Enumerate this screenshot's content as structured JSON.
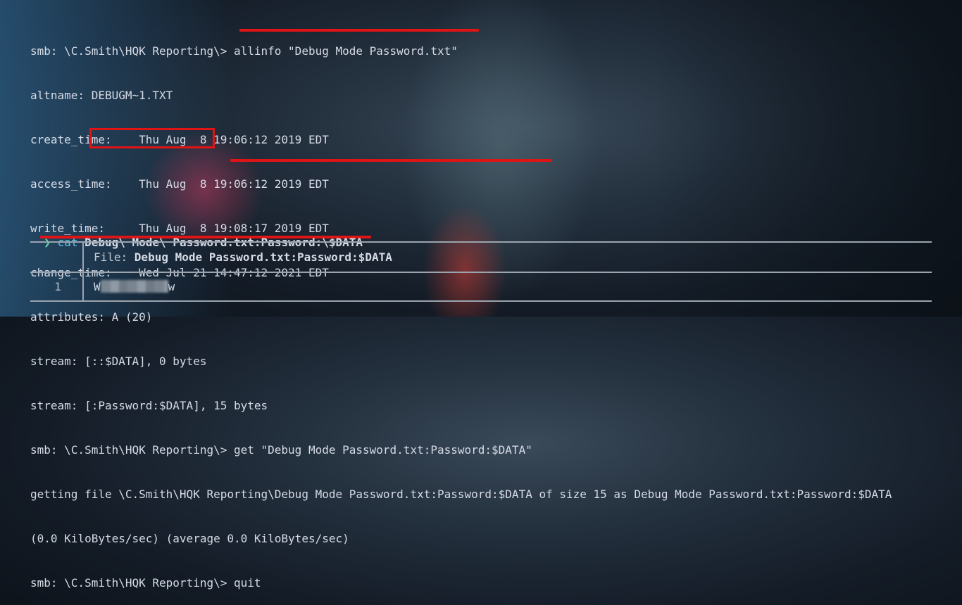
{
  "terminal": {
    "lines": [
      "smb: \\C.Smith\\HQK Reporting\\> allinfo \"Debug Mode Password.txt\"",
      "altname: DEBUGM~1.TXT",
      "create_time:    Thu Aug  8 19:06:12 2019 EDT",
      "access_time:    Thu Aug  8 19:06:12 2019 EDT",
      "write_time:     Thu Aug  8 19:08:17 2019 EDT",
      "change_time:    Wed Jul 21 14:47:12 2021 EDT",
      "attributes: A (20)",
      "stream: [::$DATA], 0 bytes",
      "stream: [:Password:$DATA], 15 bytes",
      "smb: \\C.Smith\\HQK Reporting\\> get \"Debug Mode Password.txt:Password:$DATA\"",
      "getting file \\C.Smith\\HQK Reporting\\Debug Mode Password.txt:Password:$DATA of size 15 as Debug Mode Password.txt:Password:$DATA",
      "(0.0 KiloBytes/sec) (average 0.0 KiloBytes/sec)",
      "smb: \\C.Smith\\HQK Reporting\\> quit"
    ],
    "prompt_symbol": "❯",
    "cmd_name": "cat",
    "cmd_args": "Debug\\ Mode\\ Password.txt:Password:\\$DATA"
  },
  "bat": {
    "file_label": "File: ",
    "file_name": "Debug Mode Password.txt:Password:$DATA",
    "line_number": "1",
    "content_start": "W",
    "content_end": "w"
  },
  "colors": {
    "highlight": "#e01414",
    "prompt": "#5fd7a0",
    "command": "#5fc7e6"
  }
}
